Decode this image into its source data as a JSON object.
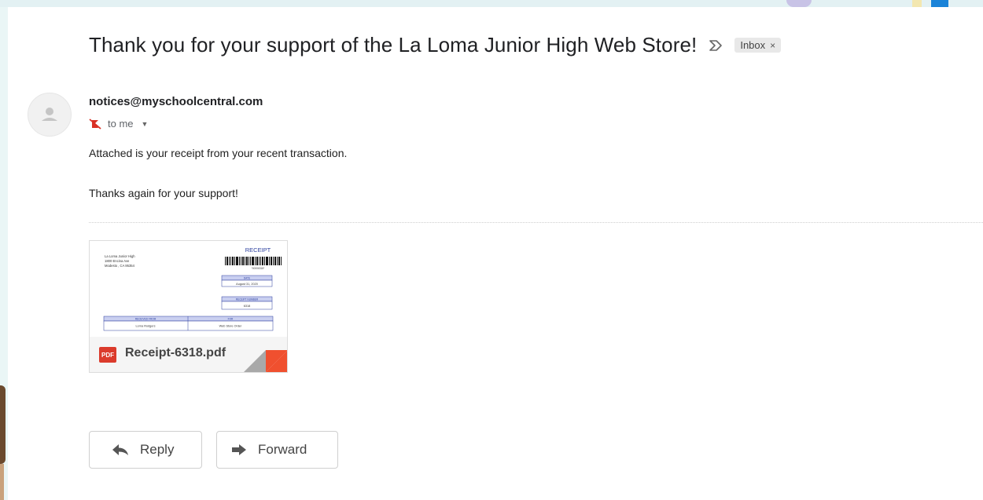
{
  "email": {
    "subject": "Thank you for your support of the La Loma Junior High Web Store!",
    "label": "Inbox",
    "label_close": "×",
    "sender": "notices@myschoolcentral.com",
    "recipient_text": "to me",
    "body": [
      "Attached is your receipt from your recent transaction.",
      "Thanks again for your support!"
    ]
  },
  "attachment": {
    "file_name": "Receipt-6318.pdf",
    "file_type_badge": "PDF",
    "preview": {
      "title": "RECEIPT",
      "org_lines": [
        "La Loma Junior High",
        "1800 Encina Ave",
        "Modesto , CA 95354"
      ],
      "barcode_number": "*00006318*",
      "date_label": "DATE",
      "date_value": "August 31, 2020",
      "receipt_number_label": "RECEIPT NUMBER",
      "receipt_number_value": "6318",
      "received_from_label": "RECEIVED FROM",
      "received_from_value": "Lorna Rodgers",
      "for_label": "FOR",
      "for_value": "Web Store Order"
    }
  },
  "actions": {
    "reply_label": "Reply",
    "forward_label": "Forward"
  },
  "colors": {
    "pdf_red": "#db3b2c",
    "receipt_blue": "#2b3f9e",
    "label_chip_bg": "#e8e8e8"
  },
  "icons": {
    "importance": "importance-marker-icon",
    "avatar": "default-avatar-icon",
    "unsubscribe": "notifications-off-icon",
    "details": "chevron-down-icon",
    "reply": "reply-arrow-icon",
    "forward": "forward-arrow-icon"
  }
}
